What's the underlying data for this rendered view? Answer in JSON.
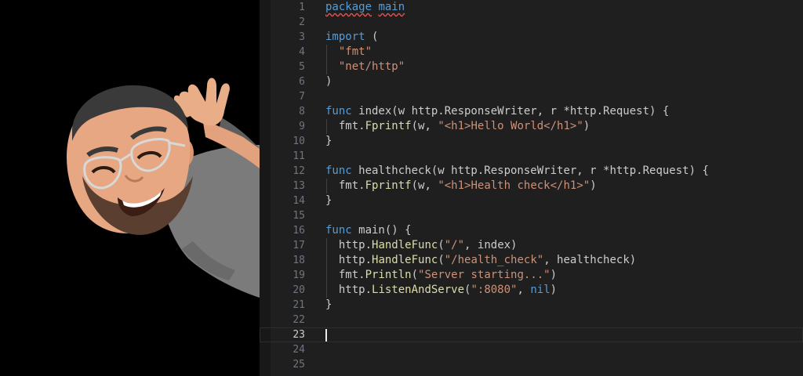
{
  "colors": {
    "editor_bg": "#1f1f1f",
    "keyword": "#569cd6",
    "string": "#ce9178",
    "function": "#dcdcaa",
    "text": "#cccccc",
    "line_number": "#6e7681"
  },
  "avatar": {
    "icon": "waving-bitmoji-avatar-icon"
  },
  "editor": {
    "current_line": 23,
    "lines": [
      {
        "n": "1",
        "tokens": [
          {
            "t": "package",
            "k": "squiggle"
          },
          {
            "t": " ",
            "k": "plain"
          },
          {
            "t": "main",
            "k": "squiggle"
          }
        ]
      },
      {
        "n": "2",
        "tokens": []
      },
      {
        "n": "3",
        "tokens": [
          {
            "t": "import",
            "k": "kw"
          },
          {
            "t": " (",
            "k": "plain"
          }
        ]
      },
      {
        "n": "4",
        "guide": true,
        "tokens": [
          {
            "t": "  ",
            "k": "plain"
          },
          {
            "t": "\"fmt\"",
            "k": "str"
          }
        ]
      },
      {
        "n": "5",
        "guide": true,
        "tokens": [
          {
            "t": "  ",
            "k": "plain"
          },
          {
            "t": "\"net/http\"",
            "k": "str"
          }
        ]
      },
      {
        "n": "6",
        "tokens": [
          {
            "t": ")",
            "k": "plain"
          }
        ]
      },
      {
        "n": "7",
        "tokens": []
      },
      {
        "n": "8",
        "tokens": [
          {
            "t": "func",
            "k": "kw"
          },
          {
            "t": " index(w http.ResponseWriter, r *http.Request) {",
            "k": "plain"
          }
        ]
      },
      {
        "n": "9",
        "guide": true,
        "tokens": [
          {
            "t": "  fmt.",
            "k": "plain"
          },
          {
            "t": "Fprintf",
            "k": "fn"
          },
          {
            "t": "(w, ",
            "k": "plain"
          },
          {
            "t": "\"<h1>Hello World</h1>\"",
            "k": "str"
          },
          {
            "t": ")",
            "k": "plain"
          }
        ]
      },
      {
        "n": "10",
        "tokens": [
          {
            "t": "}",
            "k": "plain"
          }
        ]
      },
      {
        "n": "11",
        "tokens": []
      },
      {
        "n": "12",
        "tokens": [
          {
            "t": "func",
            "k": "kw"
          },
          {
            "t": " healthcheck(w http.ResponseWriter, r *http.Request) {",
            "k": "plain"
          }
        ]
      },
      {
        "n": "13",
        "guide": true,
        "tokens": [
          {
            "t": "  fmt.",
            "k": "plain"
          },
          {
            "t": "Fprintf",
            "k": "fn"
          },
          {
            "t": "(w, ",
            "k": "plain"
          },
          {
            "t": "\"<h1>Health check</h1>\"",
            "k": "str"
          },
          {
            "t": ")",
            "k": "plain"
          }
        ]
      },
      {
        "n": "14",
        "tokens": [
          {
            "t": "}",
            "k": "plain"
          }
        ]
      },
      {
        "n": "15",
        "tokens": []
      },
      {
        "n": "16",
        "tokens": [
          {
            "t": "func",
            "k": "kw"
          },
          {
            "t": " main() {",
            "k": "plain"
          }
        ]
      },
      {
        "n": "17",
        "guide": true,
        "tokens": [
          {
            "t": "  http.",
            "k": "plain"
          },
          {
            "t": "HandleFunc",
            "k": "fn"
          },
          {
            "t": "(",
            "k": "plain"
          },
          {
            "t": "\"/\"",
            "k": "str"
          },
          {
            "t": ", index)",
            "k": "plain"
          }
        ]
      },
      {
        "n": "18",
        "guide": true,
        "tokens": [
          {
            "t": "  http.",
            "k": "plain"
          },
          {
            "t": "HandleFunc",
            "k": "fn"
          },
          {
            "t": "(",
            "k": "plain"
          },
          {
            "t": "\"/health_check\"",
            "k": "str"
          },
          {
            "t": ", healthcheck)",
            "k": "plain"
          }
        ]
      },
      {
        "n": "19",
        "guide": true,
        "tokens": [
          {
            "t": "  fmt.",
            "k": "plain"
          },
          {
            "t": "Println",
            "k": "fn"
          },
          {
            "t": "(",
            "k": "plain"
          },
          {
            "t": "\"Server starting...\"",
            "k": "str"
          },
          {
            "t": ")",
            "k": "plain"
          }
        ]
      },
      {
        "n": "20",
        "guide": true,
        "tokens": [
          {
            "t": "  http.",
            "k": "plain"
          },
          {
            "t": "ListenAndServe",
            "k": "fn"
          },
          {
            "t": "(",
            "k": "plain"
          },
          {
            "t": "\":8080\"",
            "k": "str"
          },
          {
            "t": ", ",
            "k": "plain"
          },
          {
            "t": "nil",
            "k": "kw"
          },
          {
            "t": ")",
            "k": "plain"
          }
        ]
      },
      {
        "n": "21",
        "tokens": [
          {
            "t": "}",
            "k": "plain"
          }
        ]
      },
      {
        "n": "22",
        "tokens": []
      },
      {
        "n": "23",
        "tokens": []
      },
      {
        "n": "24",
        "tokens": []
      },
      {
        "n": "25",
        "tokens": []
      }
    ]
  }
}
